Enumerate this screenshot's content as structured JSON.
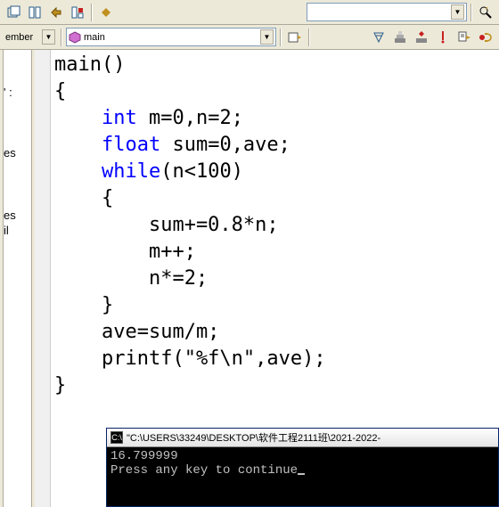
{
  "toolbar2": {
    "member_label": "ember",
    "func_combo": "main"
  },
  "left_fragments": {
    "l1": "' :",
    "l2": "es",
    "l3": "es",
    "l4": "il"
  },
  "code": {
    "line1": "main()",
    "line2": "{",
    "line3_pre": "    ",
    "line3_kw": "int",
    "line3_post": " m=0,n=2;",
    "line4_pre": "    ",
    "line4_kw": "float",
    "line4_post": " sum=0,ave;",
    "line5_pre": "    ",
    "line5_kw": "while",
    "line5_post": "(n<100)",
    "line6": "    {",
    "line7": "        sum+=0.8*n;",
    "line8": "        m++;",
    "line9": "        n*=2;",
    "line10": "    }",
    "line11": "    ave=sum/m;",
    "line12": "    printf(\"%f\\n\",ave);",
    "line13": "}"
  },
  "console": {
    "title": "\"C:\\USERS\\33249\\DESKTOP\\软件工程2111班\\2021-2022-",
    "out_line1": "16.799999",
    "out_line2": "Press any key to continue"
  }
}
